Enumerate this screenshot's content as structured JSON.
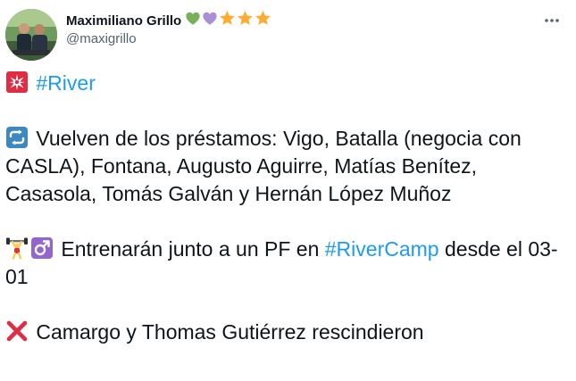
{
  "author": {
    "display_name": "Maximiliano Grillo",
    "handle": "@maxigrillo",
    "badges": [
      "green-heart-icon",
      "purple-heart-icon",
      "star-icon",
      "star-icon",
      "star-icon"
    ]
  },
  "colors": {
    "link": "#1d9bf0",
    "text": "#0f1419",
    "secondary": "#536471"
  },
  "tweet": {
    "line1": {
      "icon": "siren-icon",
      "hashtag": "#River"
    },
    "line2": {
      "icon": "repeat-arrows-icon",
      "text": "Vuelven de los préstamos: Vigo, Batalla (negocia con CASLA), Fontana, Augusto Aguirre, Matías Benítez, Casasola, Tomás Galván y Hernán López Muñoz"
    },
    "line3": {
      "icons": [
        "weightlifter-icon",
        "male-sign-icon"
      ],
      "text_before": "Entrenarán junto a un PF en",
      "hashtag": "#RiverCamp",
      "text_after": "desde el 03-01"
    },
    "line4": {
      "icon": "cross-mark-icon",
      "text": "Camargo y Thomas Gutiérrez rescindieron"
    }
  }
}
